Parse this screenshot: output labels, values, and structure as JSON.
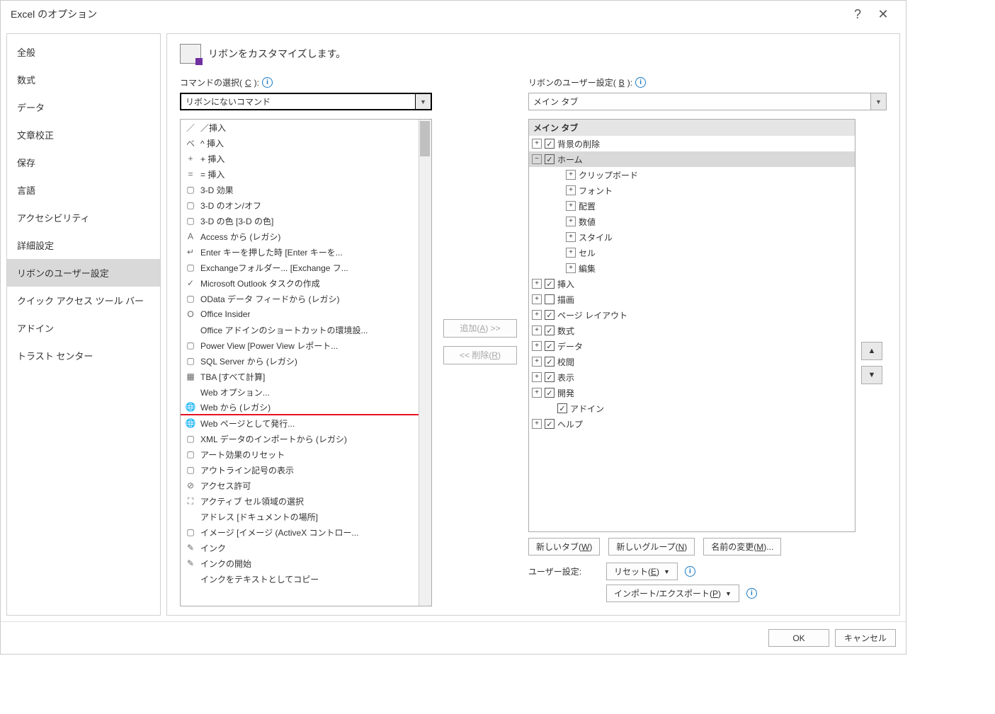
{
  "titlebar": {
    "title": "Excel のオプション"
  },
  "sidebar": {
    "items": [
      {
        "label": "全般"
      },
      {
        "label": "数式"
      },
      {
        "label": "データ"
      },
      {
        "label": "文章校正"
      },
      {
        "label": "保存"
      },
      {
        "label": "言語"
      },
      {
        "label": "アクセシビリティ"
      },
      {
        "label": "詳細設定"
      },
      {
        "label": "リボンのユーザー設定",
        "selected": true
      },
      {
        "label": "クイック アクセス ツール バー"
      },
      {
        "label": "アドイン"
      },
      {
        "label": "トラスト センター"
      }
    ]
  },
  "main_title": "リボンをカスタマイズします。",
  "left": {
    "label_pre": "コマンドの選択(",
    "label_u": "C",
    "label_post": "):",
    "combo_value": "リボンにないコマンド",
    "items": [
      {
        "icon": "／",
        "text": "／挿入"
      },
      {
        "icon": "ベ",
        "text": "^ 挿入"
      },
      {
        "icon": "+",
        "text": "+ 挿入"
      },
      {
        "icon": "=",
        "text": "= 挿入"
      },
      {
        "icon": "▢",
        "text": "3-D 効果",
        "arrow": true
      },
      {
        "icon": "▢",
        "text": "3-D のオン/オフ"
      },
      {
        "icon": "▢",
        "text": "3-D の色 [3-D の色]",
        "arrow": true
      },
      {
        "icon": "A",
        "text": "Access から (レガシ)"
      },
      {
        "icon": "↵",
        "text": "Enter キーを押した時 [Enter キーを..."
      },
      {
        "icon": "▢",
        "text": "Exchangeフォルダー... [Exchange フ..."
      },
      {
        "icon": "✓",
        "text": "Microsoft Outlook タスクの作成"
      },
      {
        "icon": "▢",
        "text": "OData データ フィードから (レガシ)"
      },
      {
        "icon": "O",
        "text": "Office Insider"
      },
      {
        "icon": "",
        "text": "Office アドインのショートカットの環境設..."
      },
      {
        "icon": "▢",
        "text": "Power View [Power View レポート..."
      },
      {
        "icon": "▢",
        "text": "SQL Server から (レガシ)"
      },
      {
        "icon": "▦",
        "text": "TBA [すべて計算]"
      },
      {
        "icon": "",
        "text": "Web オプション..."
      },
      {
        "icon": "🌐",
        "text": "Web から (レガシ)",
        "redline": true
      },
      {
        "icon": "🌐",
        "text": "Web ページとして発行..."
      },
      {
        "icon": "▢",
        "text": "XML データのインポートから (レガシ)"
      },
      {
        "icon": "▢",
        "text": "アート効果のリセット"
      },
      {
        "icon": "▢",
        "text": "アウトライン記号の表示"
      },
      {
        "icon": "⊘",
        "text": "アクセス許可"
      },
      {
        "icon": "⛶",
        "text": "アクティブ セル領域の選択"
      },
      {
        "icon": "",
        "text": "アドレス [ドキュメントの場所]",
        "editicon": true
      },
      {
        "icon": "▢",
        "text": "イメージ [イメージ (ActiveX コントロー..."
      },
      {
        "icon": "✎",
        "text": "インク"
      },
      {
        "icon": "✎",
        "text": "インクの開始"
      },
      {
        "icon": "",
        "text": "インクをテキストとしてコピー"
      }
    ]
  },
  "mid": {
    "add_pre": "追加(",
    "add_u": "A",
    "add_post": ") >>",
    "remove_pre": "<< 削除(",
    "remove_u": "R",
    "remove_post": ")"
  },
  "right": {
    "label_pre": "リボンのユーザー設定(",
    "label_u": "B",
    "label_post": "):",
    "combo_value": "メイン タブ",
    "tree_header": "メイン タブ",
    "nodes": [
      {
        "indent": 0,
        "toggle": "+",
        "checked": true,
        "label": "背景の削除"
      },
      {
        "indent": 0,
        "toggle": "−",
        "checked": true,
        "label": "ホーム",
        "selected": true
      },
      {
        "indent": 2,
        "toggle": "+",
        "label": "クリップボード"
      },
      {
        "indent": 2,
        "toggle": "+",
        "label": "フォント"
      },
      {
        "indent": 2,
        "toggle": "+",
        "label": "配置"
      },
      {
        "indent": 2,
        "toggle": "+",
        "label": "数値"
      },
      {
        "indent": 2,
        "toggle": "+",
        "label": "スタイル"
      },
      {
        "indent": 2,
        "toggle": "+",
        "label": "セル"
      },
      {
        "indent": 2,
        "toggle": "+",
        "label": "編集"
      },
      {
        "indent": 0,
        "toggle": "+",
        "checked": true,
        "label": "挿入"
      },
      {
        "indent": 0,
        "toggle": "+",
        "checked": false,
        "label": "描画"
      },
      {
        "indent": 0,
        "toggle": "+",
        "checked": true,
        "label": "ページ レイアウト"
      },
      {
        "indent": 0,
        "toggle": "+",
        "checked": true,
        "label": "数式"
      },
      {
        "indent": 0,
        "toggle": "+",
        "checked": true,
        "label": "データ"
      },
      {
        "indent": 0,
        "toggle": "+",
        "checked": true,
        "label": "校閲"
      },
      {
        "indent": 0,
        "toggle": "+",
        "checked": true,
        "label": "表示"
      },
      {
        "indent": 0,
        "toggle": "+",
        "checked": true,
        "label": "開発"
      },
      {
        "indent": 1,
        "checked": true,
        "label": "アドイン"
      },
      {
        "indent": 0,
        "toggle": "+",
        "checked": true,
        "label": "ヘルプ"
      }
    ],
    "new_tab_pre": "新しいタブ(",
    "new_tab_u": "W",
    "new_tab_post": ")",
    "new_group_pre": "新しいグループ(",
    "new_group_u": "N",
    "new_group_post": ")",
    "rename_pre": "名前の変更(",
    "rename_u": "M",
    "rename_post": ")...",
    "user_settings_label": "ユーザー設定:",
    "reset_pre": "リセット(",
    "reset_u": "E",
    "reset_post": ")",
    "import_pre": "インポート/エクスポート(",
    "import_u": "P",
    "import_post": ")"
  },
  "footer": {
    "ok": "OK",
    "cancel": "キャンセル"
  }
}
